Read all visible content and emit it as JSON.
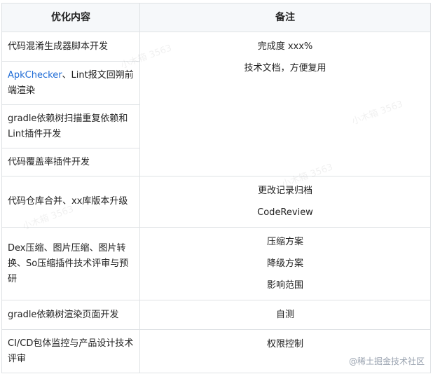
{
  "table": {
    "headers": [
      "优化内容",
      "备注"
    ],
    "rows": [
      {
        "content": "代码混淆生成器脚本开发"
      },
      {
        "content_link": "ApkChecker",
        "content_rest": "、Lint报文回朔前端渲染"
      },
      {
        "content": "gradle依赖树扫描重复依赖和Lint插件开发"
      },
      {
        "content": "代码覆盖率插件开发"
      },
      {
        "content": "代码仓库合并、xx库版本升级"
      },
      {
        "content": "Dex压缩、图片压缩、图片转换、So压缩插件技术评审与预研"
      },
      {
        "content": "gradle依赖树渲染页面开发"
      },
      {
        "content": "CI/CD包体监控与产品设计技术评审"
      }
    ],
    "notes": {
      "group1": [
        "完成度 xxx%",
        "技术文档，方便复用"
      ],
      "row5": [
        "更改记录归档",
        "CodeReview"
      ],
      "row6": [
        "压缩方案",
        "降级方案",
        "影响范围"
      ],
      "row7": [
        "自测"
      ],
      "row8": [
        "权限控制"
      ]
    }
  },
  "watermark": "@稀土掘金技术社区",
  "faint_watermark": "小木箱 3563"
}
